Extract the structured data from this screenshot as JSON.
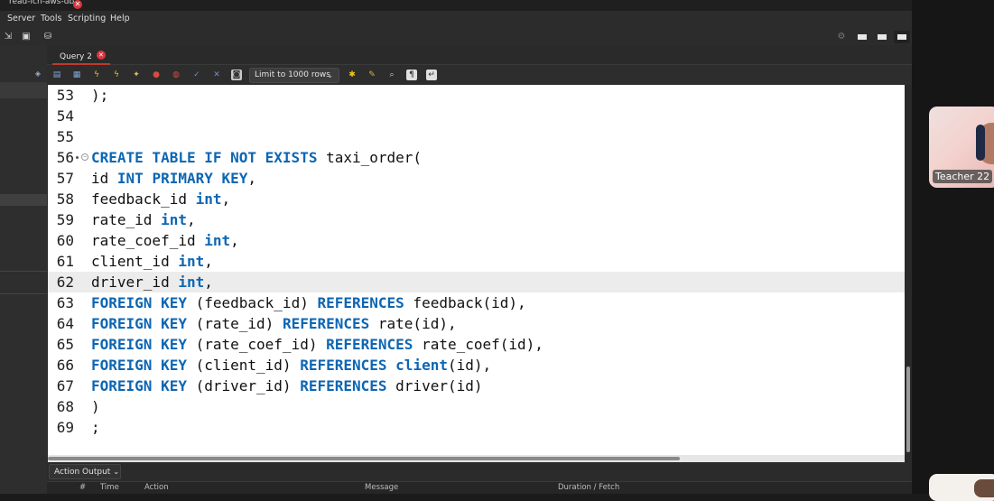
{
  "window": {
    "title": "read-ich-aws-db",
    "close_glyph": "✕"
  },
  "menubar": {
    "items": [
      "Server",
      "Tools",
      "Scripting",
      "Help"
    ]
  },
  "main_toolbar": {
    "icons": [
      "new-sql-tab-icon",
      "inspector-icon",
      "connection-icon"
    ],
    "layout_toggles": [
      "toggle-sidebar-icon",
      "toggle-output-icon",
      "toggle-secondary-sidebar-icon"
    ]
  },
  "tabbar": {
    "query_tab": {
      "label": "Query 2",
      "close_glyph": "✕"
    }
  },
  "editor_toolbar": {
    "icons": [
      "open-file-icon",
      "save-icon",
      "execute-icon",
      "execute-current-icon",
      "explain-icon",
      "stop-icon",
      "toggle-continue-icon",
      "commit-icon",
      "rollback-icon",
      "autocommit-icon"
    ],
    "limit_select": {
      "value": "Limit to 1000 rows",
      "chevron": "⌄"
    },
    "trailing_icons": [
      "beautify-icon",
      "find-icon",
      "find-replace-icon",
      "invisible-chars-icon",
      "wrap-icon"
    ]
  },
  "editor": {
    "current_line": 62,
    "lines": [
      {
        "n": "53",
        "segments": [
          {
            "t": ");",
            "k": false
          }
        ]
      },
      {
        "n": "54",
        "segments": []
      },
      {
        "n": "55",
        "segments": []
      },
      {
        "n": "56",
        "fold": true,
        "segments": [
          {
            "t": "CREATE TABLE IF NOT EXISTS",
            "k": true
          },
          {
            "t": " taxi_order(",
            "k": false
          }
        ]
      },
      {
        "n": "57",
        "segments": [
          {
            "t": "id ",
            "k": false
          },
          {
            "t": "INT PRIMARY KEY",
            "k": true
          },
          {
            "t": ",",
            "k": false
          }
        ]
      },
      {
        "n": "58",
        "segments": [
          {
            "t": "feedback_id ",
            "k": false
          },
          {
            "t": "int",
            "k": true
          },
          {
            "t": ",",
            "k": false
          }
        ]
      },
      {
        "n": "59",
        "segments": [
          {
            "t": "rate_id ",
            "k": false
          },
          {
            "t": "int",
            "k": true
          },
          {
            "t": ",",
            "k": false
          }
        ]
      },
      {
        "n": "60",
        "segments": [
          {
            "t": "rate_coef_id ",
            "k": false
          },
          {
            "t": "int",
            "k": true
          },
          {
            "t": ",",
            "k": false
          }
        ]
      },
      {
        "n": "61",
        "segments": [
          {
            "t": "client_id ",
            "k": false
          },
          {
            "t": "int",
            "k": true
          },
          {
            "t": ",",
            "k": false
          }
        ]
      },
      {
        "n": "62",
        "segments": [
          {
            "t": "driver_id ",
            "k": false
          },
          {
            "t": "int",
            "k": true
          },
          {
            "t": ",",
            "k": false
          }
        ]
      },
      {
        "n": "63",
        "segments": [
          {
            "t": "FOREIGN KEY",
            "k": true
          },
          {
            "t": " (feedback_id) ",
            "k": false
          },
          {
            "t": "REFERENCES",
            "k": true
          },
          {
            "t": " feedback(id),",
            "k": false
          }
        ]
      },
      {
        "n": "64",
        "segments": [
          {
            "t": "FOREIGN KEY",
            "k": true
          },
          {
            "t": " (rate_id) ",
            "k": false
          },
          {
            "t": "REFERENCES",
            "k": true
          },
          {
            "t": " rate(id),",
            "k": false
          }
        ]
      },
      {
        "n": "65",
        "segments": [
          {
            "t": "FOREIGN KEY",
            "k": true
          },
          {
            "t": " (rate_coef_id) ",
            "k": false
          },
          {
            "t": "REFERENCES",
            "k": true
          },
          {
            "t": " rate_coef(id),",
            "k": false
          }
        ]
      },
      {
        "n": "66",
        "segments": [
          {
            "t": "FOREIGN KEY",
            "k": true
          },
          {
            "t": " (client_id) ",
            "k": false
          },
          {
            "t": "REFERENCES",
            "k": true
          },
          {
            "t": " ",
            "k": false
          },
          {
            "t": "client",
            "k": true
          },
          {
            "t": "(id),",
            "k": false
          }
        ]
      },
      {
        "n": "67",
        "segments": [
          {
            "t": "FOREIGN KEY",
            "k": true
          },
          {
            "t": " (driver_id) ",
            "k": false
          },
          {
            "t": "REFERENCES",
            "k": true
          },
          {
            "t": " driver(id)",
            "k": false
          }
        ]
      },
      {
        "n": "68",
        "segments": [
          {
            "t": ")",
            "k": false
          }
        ]
      },
      {
        "n": "69",
        "segments": [
          {
            "t": ";",
            "k": false
          }
        ]
      }
    ]
  },
  "output": {
    "selector_label": "Action Output",
    "chevron": "⌄",
    "columns": [
      "#",
      "Time",
      "Action",
      "Message",
      "Duration / Fetch"
    ]
  },
  "video": {
    "name": "Teacher 22"
  },
  "colors": {
    "keyword": "#0d66b3",
    "accent_close": "#d9363e",
    "editor_bg": "#ffffff"
  }
}
